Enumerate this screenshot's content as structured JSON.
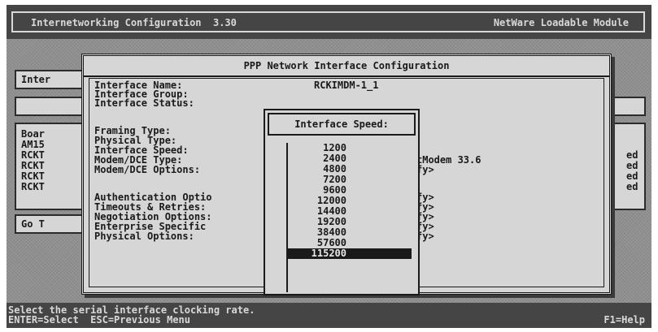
{
  "header": {
    "title_left": "Internetworking Configuration  3.30",
    "title_right": "NetWare Loadable Module"
  },
  "background": {
    "inter_tab": "Inter",
    "board_rows": [
      "Boar",
      "AM15",
      "RCKT",
      "RCKT",
      "RCKT",
      "RCKT"
    ],
    "right_status": [
      "ed",
      "ed",
      "ed",
      "ed"
    ],
    "go_label": "Go T"
  },
  "ppp_window": {
    "title": "PPP Network Interface Configuration",
    "fields": [
      {
        "label": "Interface Name:",
        "value": "RCKIMDM-1_1"
      },
      {
        "label": "Interface Group:",
        "value": ""
      },
      {
        "label": "Interface Status:",
        "value": ""
      },
      {
        "label": "Framing Type:",
        "value": ""
      },
      {
        "label": "Physical Type:",
        "value": ""
      },
      {
        "label": "Interface Speed:",
        "value": ""
      },
      {
        "label": "Modem/DCE Type:",
        "value": "tModem 33.6"
      },
      {
        "label": "Modem/DCE Options:",
        "value": "fy>"
      },
      {
        "label": "Authentication Optio",
        "value": "fy>"
      },
      {
        "label": "Timeouts & Retries:",
        "value": "fy>"
      },
      {
        "label": "Negotiation Options:",
        "value": "fy>"
      },
      {
        "label": "Enterprise Specific",
        "value": "fy>"
      },
      {
        "label": "Physical Options:",
        "value": "fy>"
      }
    ]
  },
  "speed_popup": {
    "title": "Interface Speed:",
    "options": [
      "1200",
      "2400",
      "4800",
      "7200",
      "9600",
      "12000",
      "14400",
      "19200",
      "38400",
      "57600",
      "115200"
    ],
    "selected": "115200"
  },
  "status": {
    "line1": "Select the serial interface clocking rate.",
    "line2": "ENTER=Select  ESC=Previous Menu",
    "help": "F1=Help"
  }
}
